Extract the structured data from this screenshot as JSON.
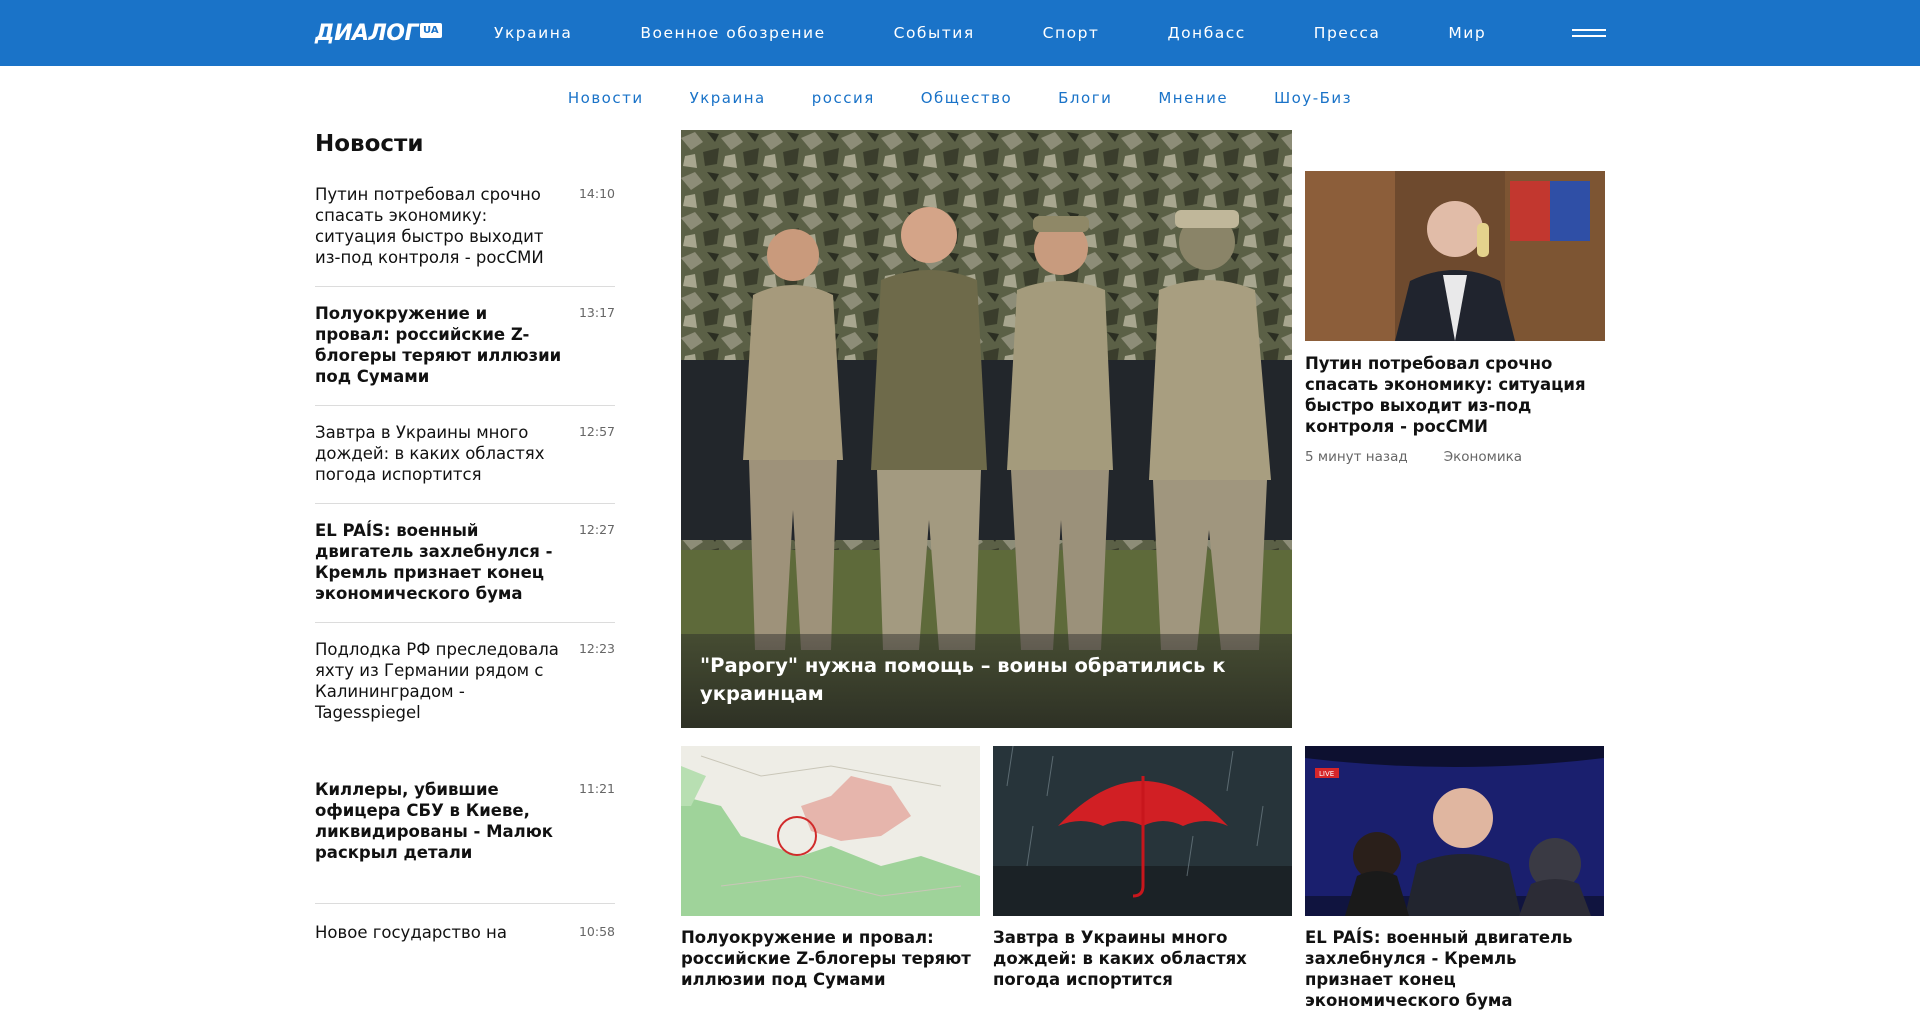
{
  "header": {
    "logo_text": "ДИАЛОГ",
    "logo_badge": "UA",
    "nav": [
      "Украина",
      "Военное обозрение",
      "События",
      "Спорт",
      "Донбасс",
      "Пресса",
      "Мир"
    ]
  },
  "subnav": [
    "Новости",
    "Украина",
    "россия",
    "Общество",
    "Блоги",
    "Мнение",
    "Шоу-Биз"
  ],
  "news": {
    "title": "Новости",
    "items": [
      {
        "text": "Путин потребовал срочно спасать экономику: ситуация быстро выходит из-под контроля - росСМИ",
        "time": "14:10",
        "bold": false
      },
      {
        "text": "Полуокружение и провал: российские Z-блогеры теряют иллюзии под Сумами",
        "time": "13:17",
        "bold": true
      },
      {
        "text": "Завтра в Украины много дождей: в каких областях погода испортится",
        "time": "12:57",
        "bold": false
      },
      {
        "text": "EL PAÍS: военный двигатель захлебнулся - Кремль признает конец экономического бума",
        "time": "12:27",
        "bold": true
      },
      {
        "text": "Подлодка РФ преследовала яхту из Германии рядом с Калининградом - Tagesspiegel",
        "time": "12:23",
        "bold": false
      },
      {
        "text": "Киллеры, убившие офицера СБУ в Киеве, ликвидированы - Малюк раскрыл детали",
        "time": "11:21",
        "bold": true
      },
      {
        "text": "Новое государство на",
        "time": "10:58",
        "bold": false
      }
    ]
  },
  "hero": {
    "caption": "\"Рарогу\" нужна помощь – воины обратились к украинцам"
  },
  "side": {
    "title": "Путин потребовал срочно спасать экономику: ситуация быстро выходит из-под контроля - росСМИ",
    "time_ago": "5 минут назад",
    "category": "Экономика"
  },
  "bottom": [
    {
      "title": "Полуокружение и провал: российские Z-блогеры теряют иллюзии под Сумами",
      "image": "map-image"
    },
    {
      "title": "Завтра в Украины много дождей: в каких областях погода испортится",
      "image": "umbrella-image"
    },
    {
      "title": "EL PAÍS: военный двигатель захлебнулся - Кремль признает конец экономического бума",
      "image": "screen-image",
      "badge": "LIVE"
    }
  ],
  "colors": {
    "brand": "#1a73c8",
    "text": "#111111",
    "muted": "#666666"
  }
}
